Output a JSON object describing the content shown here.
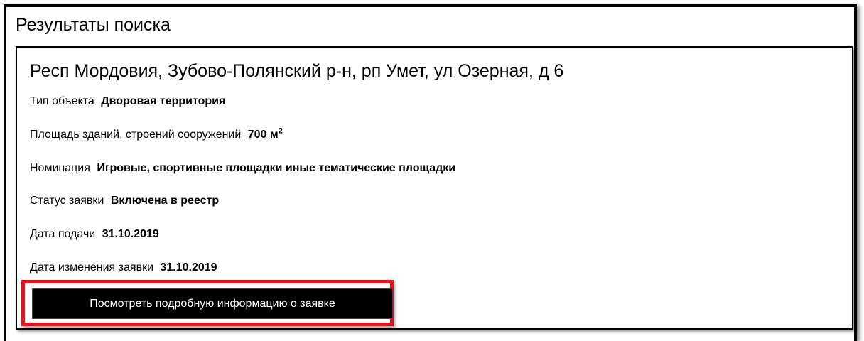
{
  "page": {
    "title": "Результаты поиска"
  },
  "result": {
    "address": "Респ Мордовия, Зубово-Полянский р-н, рп Умет, ул Озерная, д 6",
    "fields": {
      "object_type": {
        "label": "Тип объекта",
        "value": "Дворовая территория"
      },
      "area": {
        "label": "Площадь зданий, строений сооружений",
        "value": "700 м",
        "unit_exponent": "2"
      },
      "nomination": {
        "label": "Номинация",
        "value": "Игровые, спортивные площадки иные тематические площадки"
      },
      "status": {
        "label": "Статус заявки",
        "value": "Включена в реестр"
      },
      "date_submitted": {
        "label": "Дата подачи",
        "value": "31.10.2019"
      },
      "date_changed": {
        "label": "Дата изменения заявки",
        "value": "31.10.2019"
      }
    },
    "details_button_label": "Посмотреть подробную информацию о заявке"
  },
  "colors": {
    "highlight_border": "#e8141b",
    "button_background": "#000000",
    "button_text": "#ffffff"
  }
}
